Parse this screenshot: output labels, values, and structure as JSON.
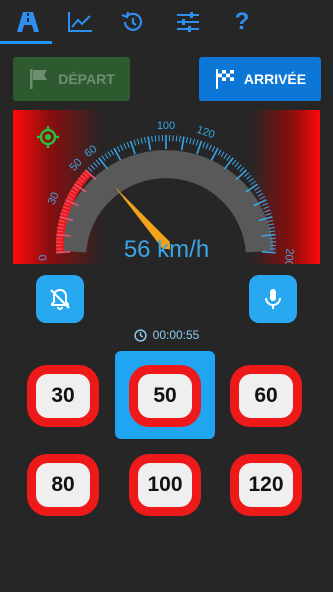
{
  "tabs": [
    {
      "icon": "road-icon",
      "active": true
    },
    {
      "icon": "chart-icon",
      "active": false
    },
    {
      "icon": "history-icon",
      "active": false
    },
    {
      "icon": "settings-sliders-icon",
      "active": false
    },
    {
      "icon": "help-icon",
      "active": false,
      "label": "?"
    }
  ],
  "buttons": {
    "depart": {
      "label": "DÉPART",
      "icon": "flag-icon"
    },
    "arrivee": {
      "label": "ARRIVÉE",
      "icon": "checkered-flag-icon"
    }
  },
  "speedometer": {
    "min": 0,
    "max": 200,
    "value": 56,
    "major_ticks": [
      0,
      10,
      20,
      30,
      40,
      50,
      60,
      70,
      80,
      90,
      100,
      110,
      120,
      130,
      140,
      150,
      160,
      170,
      180,
      190,
      200
    ],
    "labels": [
      "0",
      "30",
      "50",
      "60",
      "100",
      "120",
      "200"
    ],
    "limit": 50,
    "readout": "56 km/h",
    "gps_icon": "gps-target-icon"
  },
  "controls": {
    "mute_icon": "bell-off-icon",
    "mic_icon": "microphone-icon"
  },
  "timer": {
    "icon": "clock-icon",
    "value": "00:00:55"
  },
  "limits": [
    {
      "value": "30",
      "selected": false
    },
    {
      "value": "50",
      "selected": true
    },
    {
      "value": "60",
      "selected": false
    },
    {
      "value": "80",
      "selected": false
    },
    {
      "value": "100",
      "selected": false
    },
    {
      "value": "120",
      "selected": false
    }
  ],
  "colors": {
    "accent": "#2196f3",
    "danger": "#ee1a1a",
    "background": "#262626",
    "gauge_blue": "#3aa6e8",
    "needle": "#f5a31a"
  }
}
